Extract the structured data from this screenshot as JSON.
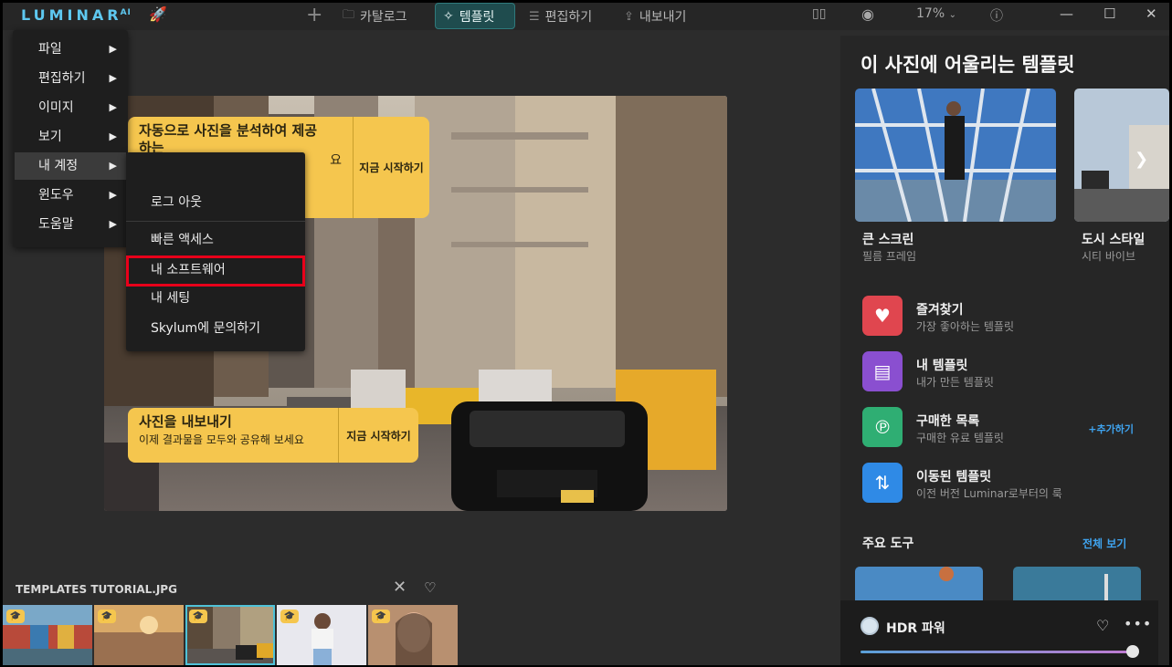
{
  "app": {
    "logo": "LUMINAR",
    "logo_sup": "AI"
  },
  "toolbar": {
    "catalog": "카탈로그",
    "templates": "템플릿",
    "edit": "편집하기",
    "export": "내보내기",
    "zoom": "17%"
  },
  "menu": {
    "items": [
      {
        "label": "파일"
      },
      {
        "label": "편집하기"
      },
      {
        "label": "이미지"
      },
      {
        "label": "보기"
      },
      {
        "label": "내 계정"
      },
      {
        "label": "윈도우"
      },
      {
        "label": "도움말"
      }
    ],
    "arrow": "▶"
  },
  "submenu": {
    "items": [
      {
        "label": "로그 아웃"
      },
      {
        "label": "빠른 액세스"
      },
      {
        "label": "내 소프트웨어"
      },
      {
        "label": "내 세팅"
      },
      {
        "label": "Skylum에 문의하기"
      }
    ]
  },
  "tips": {
    "top": {
      "title_line1": "자동으로 사진을 분석하여 제공",
      "title_line2": "하는",
      "sub": "요",
      "action": "지금 시작하기"
    },
    "bottom": {
      "title": "사진을 내보내기",
      "sub": "이제 결과물을 모두와 공유해 보세요",
      "action": "지금 시작하기"
    }
  },
  "filmstrip": {
    "title": "TEMPLATES TUTORIAL.JPG"
  },
  "panel": {
    "title": "이 사진에 어울리는 템플릿",
    "cards": [
      {
        "name": "큰 스크린",
        "sub": "필름 프레임"
      },
      {
        "name": "도시 스타일",
        "sub": "시티 바이브"
      }
    ],
    "categories": [
      {
        "name": "즐겨찾기",
        "sub": "가장 좋아하는 템플릿",
        "color": "#e0464f"
      },
      {
        "name": "내 템플릿",
        "sub": "내가 만든 템플릿",
        "color": "#8a4fd0"
      },
      {
        "name": "구매한 목록",
        "sub": "구매한 유료 템플릿",
        "color": "#2fae73",
        "action": "+추가하기"
      },
      {
        "name": "이동된 템플릿",
        "sub": "이전 버전 Luminar로부터의 룩",
        "color": "#2f8ae6"
      }
    ],
    "tools": {
      "title": "주요 도구",
      "all": "전체 보기"
    },
    "hdr": {
      "name": "HDR 파워"
    }
  }
}
